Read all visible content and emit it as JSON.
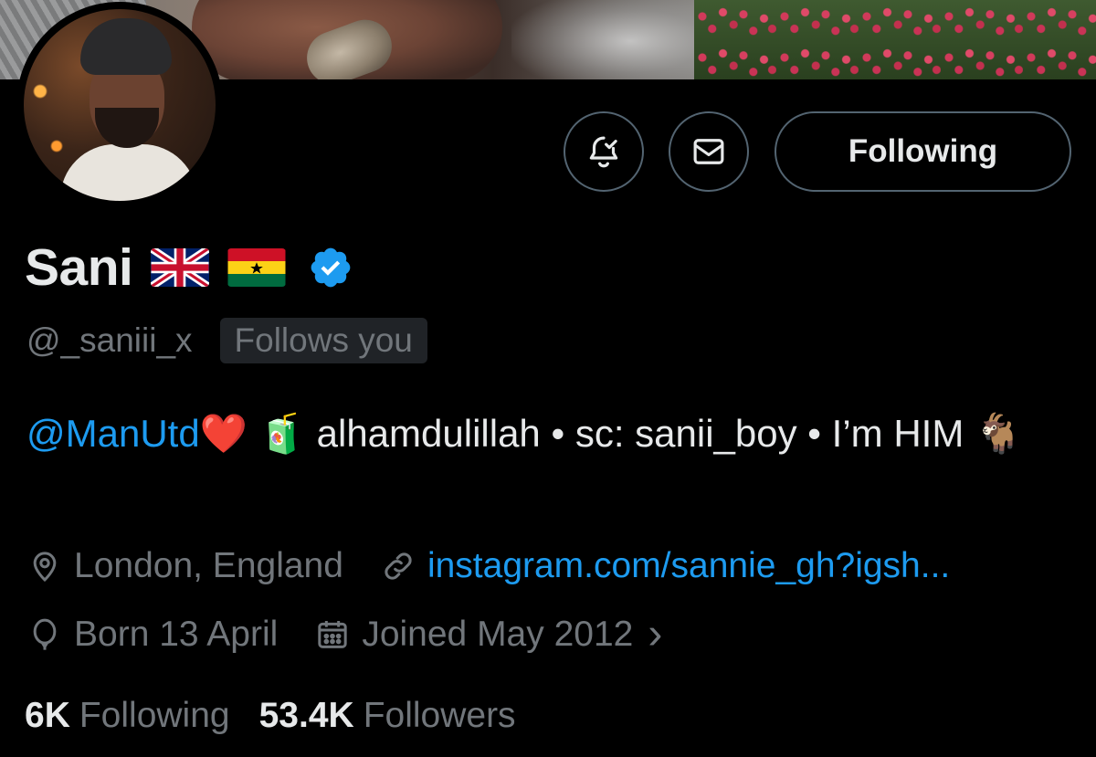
{
  "profile": {
    "name": "Sani",
    "handle": "@_saniii_x",
    "follows_you": "Follows you",
    "flags": [
      "uk-flag",
      "ghana-flag"
    ],
    "verified": true
  },
  "actions": {
    "notify_icon": "bell-check-icon",
    "message_icon": "envelope-icon",
    "follow_label": "Following"
  },
  "bio": {
    "mention": "@ManUtd",
    "heart": "❤️",
    "juice": "🧃",
    "text_1": " alhamdulillah • sc: sanii_boy • I’m HIM ",
    "goat": "🐐"
  },
  "meta": {
    "location": "London, England",
    "website": "instagram.com/sannie_gh?igsh...",
    "birthday": "Born 13 April",
    "joined": "Joined May 2012",
    "joined_chevron": "›"
  },
  "stats": {
    "following_count": "6K",
    "following_label": "Following",
    "followers_count": "53.4K",
    "followers_label": "Followers"
  },
  "colors": {
    "accent": "#1d9bf0",
    "muted": "#71767b",
    "text": "#e7e9ea",
    "border": "#536471",
    "background": "#000000"
  }
}
